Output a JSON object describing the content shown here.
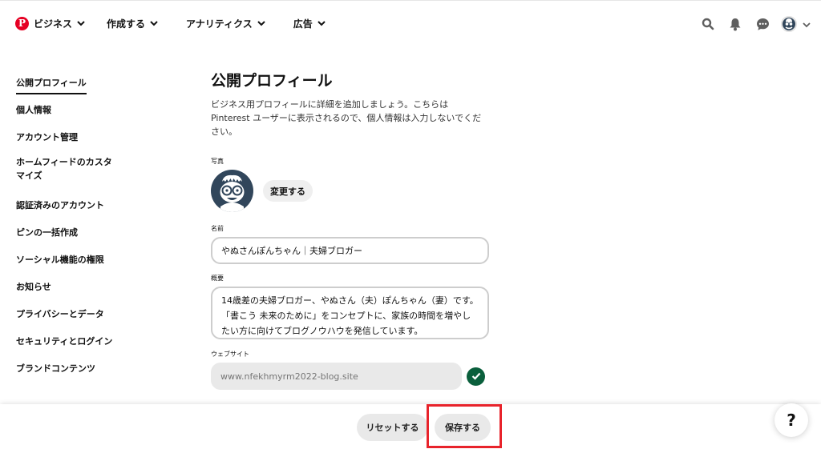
{
  "nav": {
    "items": [
      {
        "label": "ビジネス"
      },
      {
        "label": "作成する"
      },
      {
        "label": "アナリティクス"
      },
      {
        "label": "広告"
      }
    ],
    "logo_letter": "P",
    "icons": [
      "search-icon",
      "bell-icon",
      "chat-icon",
      "avatar",
      "chevron-down-icon"
    ]
  },
  "sidebar": {
    "items": [
      {
        "label": "公開プロフィール",
        "active": true
      },
      {
        "label": "個人情報"
      },
      {
        "label": "アカウント管理"
      },
      {
        "label": "ホームフィードのカスタマイズ"
      },
      {
        "label": "認証済みのアカウント"
      },
      {
        "label": "ピンの一括作成"
      },
      {
        "label": "ソーシャル機能の権限"
      },
      {
        "label": "お知らせ"
      },
      {
        "label": "プライバシーとデータ"
      },
      {
        "label": "セキュリティとログイン"
      },
      {
        "label": "ブランドコンテンツ"
      }
    ]
  },
  "main": {
    "title": "公開プロフィール",
    "description": "ビジネス用プロフィールに詳細を追加しましょう。こちらは Pinterest ユーザーに表示されるので、個人情報は入力しないでください。",
    "photo_label": "写真",
    "change_button": "変更する",
    "name_label": "名前",
    "name_value": "やぬさんぽんちゃん｜夫婦ブロガー",
    "about_label": "概要",
    "about_value": "14歳差の夫婦ブロガー、やぬさん（夫）ぽんちゃん（妻）です。「書こう 未来のために」をコンセプトに、家族の時間を増やしたい方に向けてブログノウハウを発信しています。",
    "website_label": "ウェブサイト",
    "website_value": "www.nfekhmyrm2022-blog.site"
  },
  "footer": {
    "reset_button": "リセットする",
    "save_button": "保存する",
    "help_label": "?"
  },
  "colors": {
    "brand": "#e60023",
    "verified": "#0a5f3c",
    "highlight": "#e8232b"
  }
}
